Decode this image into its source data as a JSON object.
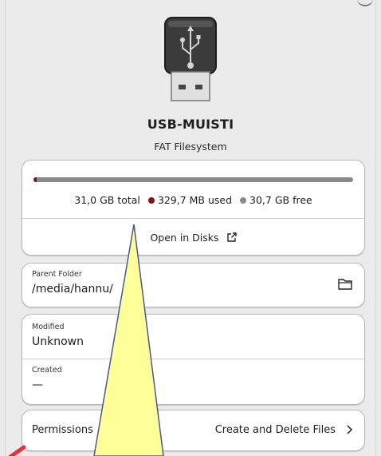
{
  "device": {
    "name": "USB-MUISTI",
    "filesystem": "FAT Filesystem",
    "icon": "usb-drive-icon"
  },
  "usage": {
    "total": "31,0 GB total",
    "used": "329,7 MB used",
    "free": "30,7 GB free",
    "used_fraction": 0.0106,
    "used_color": "#8b1010",
    "free_color": "#8a8a8a",
    "open_disks_label": "Open in Disks",
    "open_disks_icon": "external-link-icon"
  },
  "parent_folder": {
    "label": "Parent Folder",
    "path": "/media/hannu/",
    "icon": "folder-icon"
  },
  "modified": {
    "label": "Modified",
    "value": "Unknown"
  },
  "created": {
    "label": "Created",
    "value": "—"
  },
  "permissions": {
    "label": "Permissions",
    "value": "Create and Delete Files",
    "icon": "chevron-right-icon"
  },
  "annotation": {
    "callout_color": "#ffff99",
    "arrow_color": "#e8313a"
  }
}
